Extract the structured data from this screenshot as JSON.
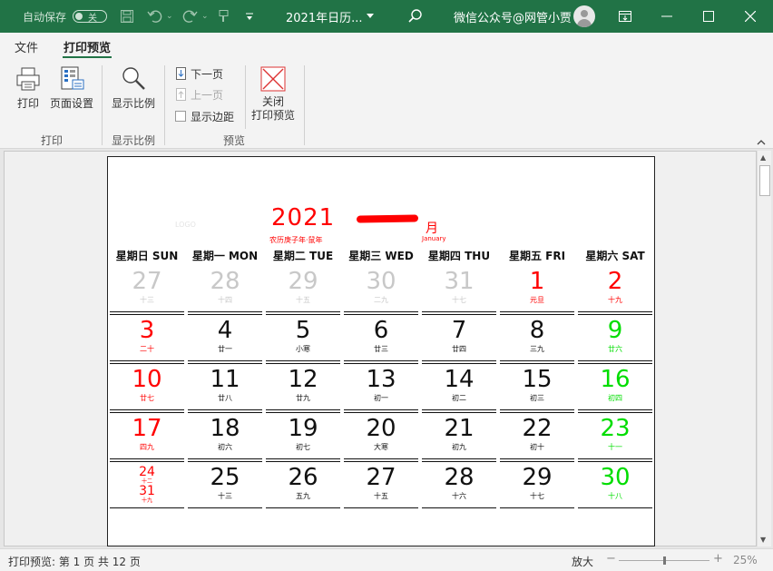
{
  "titlebar": {
    "autosave_label": "自动保存",
    "autosave_state": "关",
    "doc_title": "2021年日历...",
    "account": "微信公众号@网管小贾"
  },
  "menu": {
    "tabs": [
      "文件",
      "打印预览"
    ],
    "active_tab": "打印预览"
  },
  "ribbon": {
    "print": "打印",
    "page_setup": "页面设置",
    "zoom": "显示比例",
    "next_page": "下一页",
    "prev_page": "上一页",
    "show_margins": "显示边距",
    "close_line1": "关闭",
    "close_line2": "打印预览",
    "group_print": "打印",
    "group_zoom": "显示比例",
    "group_preview": "预览"
  },
  "calendar": {
    "logo": "LOGO",
    "year": "2021",
    "lunar_year": "农历庚子年·鼠年",
    "month_char": "月",
    "month_en": "January",
    "weekdays": [
      "星期日 SUN",
      "星期一 MON",
      "星期二 TUE",
      "星期三 WED",
      "星期四 THU",
      "星期五 FRI",
      "星期六 SAT"
    ],
    "colors": {
      "red": "#ff0000",
      "green": "#00dd00",
      "gray": "#c8c8c8",
      "black": "#111111"
    },
    "rows": [
      [
        {
          "num": "27",
          "lunar": "十三",
          "color": "gray"
        },
        {
          "num": "28",
          "lunar": "十四",
          "color": "gray"
        },
        {
          "num": "29",
          "lunar": "十五",
          "color": "gray"
        },
        {
          "num": "30",
          "lunar": "二九",
          "color": "gray"
        },
        {
          "num": "31",
          "lunar": "十七",
          "color": "gray"
        },
        {
          "num": "1",
          "lunar": "元旦",
          "color": "red"
        },
        {
          "num": "2",
          "lunar": "十九",
          "color": "red"
        }
      ],
      [
        {
          "num": "3",
          "lunar": "二十",
          "color": "red"
        },
        {
          "num": "4",
          "lunar": "廿一",
          "color": "black"
        },
        {
          "num": "5",
          "lunar": "小寒",
          "color": "black"
        },
        {
          "num": "6",
          "lunar": "廿三",
          "color": "black"
        },
        {
          "num": "7",
          "lunar": "廿四",
          "color": "black"
        },
        {
          "num": "8",
          "lunar": "三九",
          "color": "black"
        },
        {
          "num": "9",
          "lunar": "廿六",
          "color": "green"
        }
      ],
      [
        {
          "num": "10",
          "lunar": "廿七",
          "color": "red"
        },
        {
          "num": "11",
          "lunar": "廿八",
          "color": "black"
        },
        {
          "num": "12",
          "lunar": "廿九",
          "color": "black"
        },
        {
          "num": "13",
          "lunar": "初一",
          "color": "black"
        },
        {
          "num": "14",
          "lunar": "初二",
          "color": "black"
        },
        {
          "num": "15",
          "lunar": "初三",
          "color": "black"
        },
        {
          "num": "16",
          "lunar": "初四",
          "color": "green"
        }
      ],
      [
        {
          "num": "17",
          "lunar": "四九",
          "color": "red"
        },
        {
          "num": "18",
          "lunar": "初六",
          "color": "black"
        },
        {
          "num": "19",
          "lunar": "初七",
          "color": "black"
        },
        {
          "num": "20",
          "lunar": "大寒",
          "color": "black"
        },
        {
          "num": "21",
          "lunar": "初九",
          "color": "black"
        },
        {
          "num": "22",
          "lunar": "初十",
          "color": "black"
        },
        {
          "num": "23",
          "lunar": "十一",
          "color": "green"
        }
      ],
      [
        {
          "num": "24",
          "lunar": "十二",
          "num2": "31",
          "lunar2": "十九",
          "color": "red"
        },
        {
          "num": "25",
          "lunar": "十三",
          "color": "black"
        },
        {
          "num": "26",
          "lunar": "五九",
          "color": "black"
        },
        {
          "num": "27",
          "lunar": "十五",
          "color": "black"
        },
        {
          "num": "28",
          "lunar": "十六",
          "color": "black"
        },
        {
          "num": "29",
          "lunar": "十七",
          "color": "black"
        },
        {
          "num": "30",
          "lunar": "十八",
          "color": "green"
        }
      ]
    ]
  },
  "status": {
    "text": "打印预览: 第 1 页 共 12 页",
    "zoom_label": "放大",
    "zoom_minus": "−",
    "zoom_plus": "+",
    "zoom_value": "25%"
  }
}
